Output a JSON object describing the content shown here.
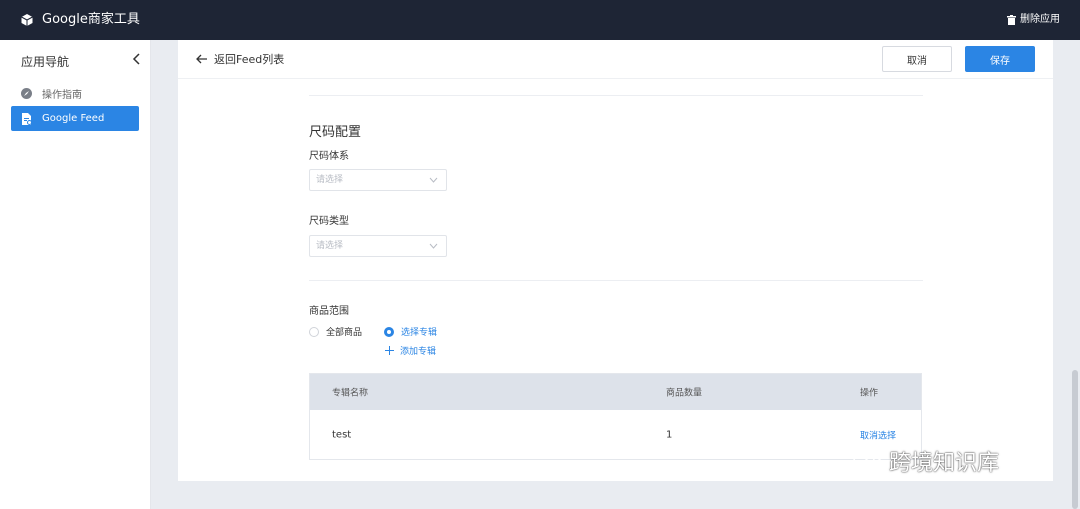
{
  "topbar": {
    "app_title": "Google商家工具",
    "delete_app": "删除应用",
    "logo_icon": "cube-icon",
    "trash_icon": "trash-icon"
  },
  "sidebar": {
    "header": "应用导航",
    "items": [
      {
        "label": "操作指南",
        "icon": "compass-icon",
        "active": false
      },
      {
        "label": "Google Feed",
        "icon": "feed-doc-icon",
        "active": true
      }
    ]
  },
  "header": {
    "back_label": "返回Feed列表",
    "cancel_label": "取消",
    "save_label": "保存"
  },
  "size_config": {
    "title": "尺码配置",
    "system_label": "尺码体系",
    "system_placeholder": "请选择",
    "type_label": "尺码类型",
    "type_placeholder": "请选择"
  },
  "product_scope": {
    "label": "商品范围",
    "options": [
      {
        "label": "全部商品",
        "checked": false
      },
      {
        "label": "选择专辑",
        "checked": true
      }
    ],
    "add_collection": "添加专辑"
  },
  "table": {
    "columns": [
      "专辑名称",
      "商品数量",
      "操作"
    ],
    "rows": [
      {
        "name": "test",
        "count": "1",
        "action": "取消选择"
      }
    ]
  },
  "watermark": {
    "text": "跨境知识库"
  },
  "colors": {
    "topbar_bg": "#1e2535",
    "accent": "#2b85e4",
    "page_bg": "#e9ecf1",
    "table_header_bg": "#dde2ea"
  }
}
